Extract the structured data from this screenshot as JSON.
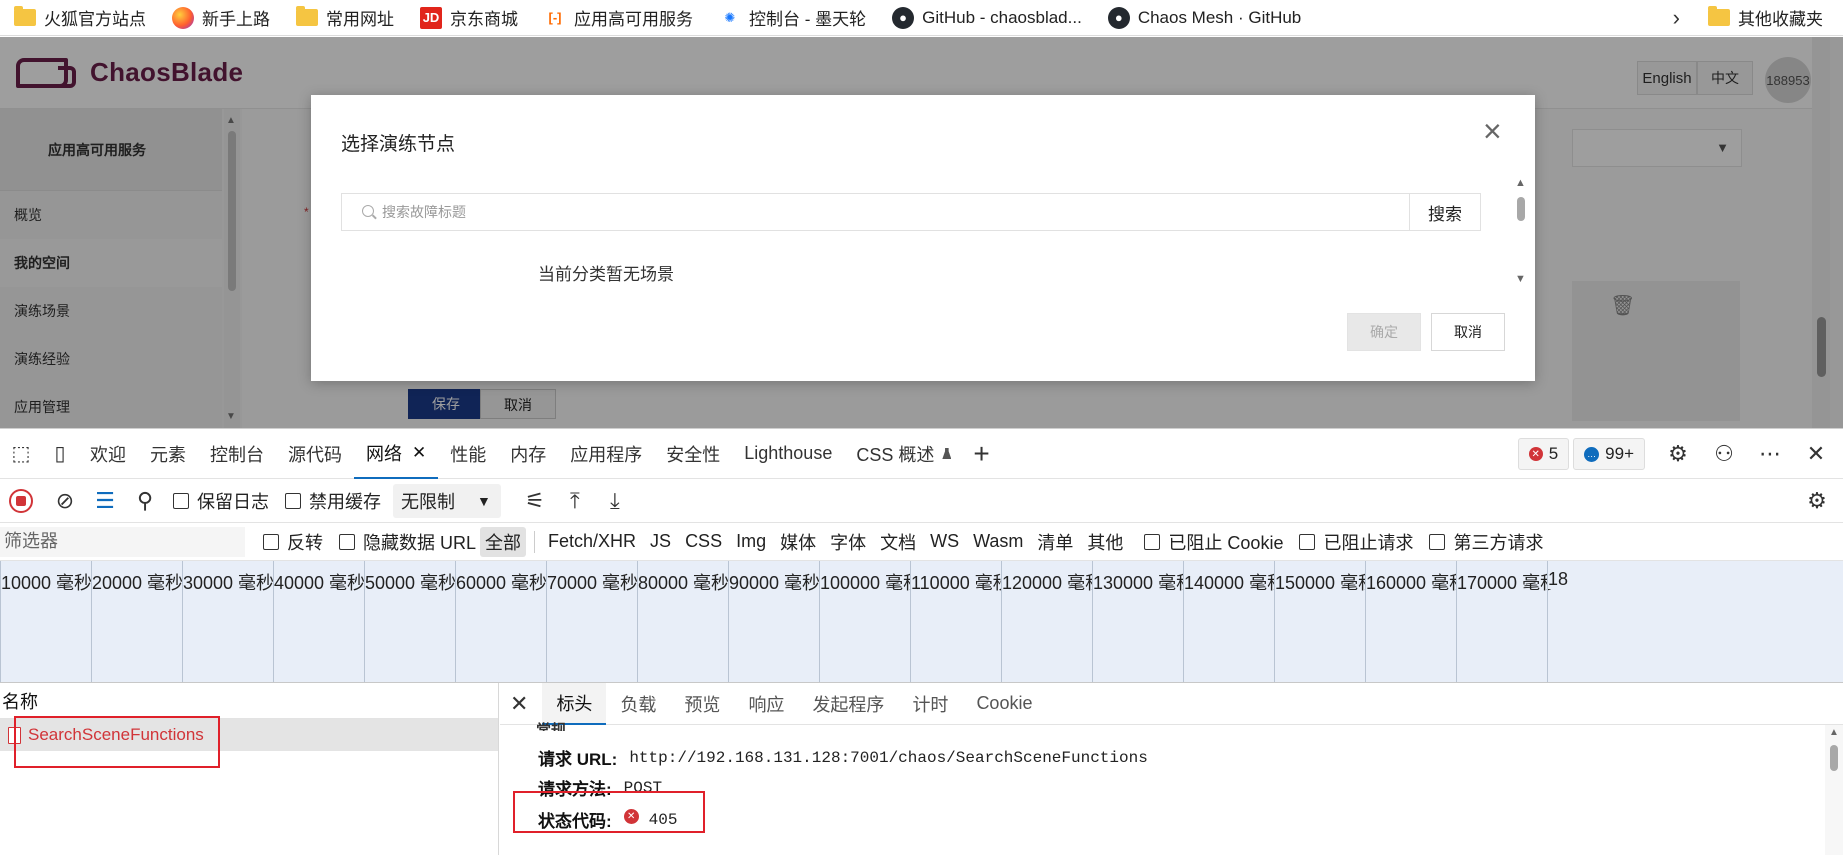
{
  "bookmarks": {
    "items": [
      {
        "label": "火狐官方站点",
        "icon": "folder-icon"
      },
      {
        "label": "新手上路",
        "icon": "firefox-icon"
      },
      {
        "label": "常用网址",
        "icon": "folder-icon"
      },
      {
        "label": "京东商城",
        "icon": "jd-icon",
        "icon_text": "JD"
      },
      {
        "label": "应用高可用服务",
        "icon": "aliyun-icon",
        "icon_text": "[-]"
      },
      {
        "label": "控制台 - 墨天轮",
        "icon": "modb-icon",
        "icon_text": "✺"
      },
      {
        "label": "GitHub - chaosblad...",
        "icon": "github-icon"
      },
      {
        "label": "Chaos Mesh · GitHub",
        "icon": "github-icon"
      }
    ],
    "more_icon": "chevron-right-icon",
    "other": {
      "label": "其他收藏夹",
      "icon": "folder-icon"
    }
  },
  "app": {
    "logo_text": "ChaosBlade",
    "lang_en": "English",
    "lang_zh": "中文",
    "avatar_text": "188953",
    "sidebar": {
      "title": "应用高可用服务",
      "items": [
        {
          "label": "概览",
          "active": false
        },
        {
          "label": "我的空间",
          "active": true
        },
        {
          "label": "演练场景",
          "active": false
        },
        {
          "label": "演练经验",
          "active": false
        },
        {
          "label": "应用管理",
          "active": false
        }
      ]
    },
    "required_mark": "*",
    "bg_save": "保存",
    "bg_cancel": "取消"
  },
  "modal": {
    "title": "选择演练节点",
    "search_placeholder": "搜索故障标题",
    "search_value": "",
    "search_button": "搜索",
    "empty_message": "当前分类暂无场景",
    "confirm": "确定",
    "cancel": "取消",
    "confirm_disabled": true
  },
  "devtools": {
    "tabs": [
      {
        "label": "欢迎",
        "active": false
      },
      {
        "label": "元素",
        "active": false
      },
      {
        "label": "控制台",
        "active": false
      },
      {
        "label": "源代码",
        "active": false
      },
      {
        "label": "网络",
        "active": true
      },
      {
        "label": "性能",
        "active": false
      },
      {
        "label": "内存",
        "active": false
      },
      {
        "label": "应用程序",
        "active": false
      },
      {
        "label": "安全性",
        "active": false
      },
      {
        "label": "Lighthouse",
        "active": false
      },
      {
        "label": "CSS 概述",
        "active": false
      }
    ],
    "error_count": "5",
    "message_count": "99+",
    "toolbar": {
      "preserve_log": "保留日志",
      "disable_cache": "禁用缓存",
      "throttle": "无限制"
    },
    "filter": {
      "placeholder": "筛选器",
      "invert": "反转",
      "hide_data_urls": "隐藏数据 URL",
      "types": [
        "全部",
        "Fetch/XHR",
        "JS",
        "CSS",
        "Img",
        "媒体",
        "字体",
        "文档",
        "WS",
        "Wasm",
        "清单",
        "其他"
      ],
      "active_type": "全部",
      "blocked_cookies": "已阻止 Cookie",
      "blocked_requests": "已阻止请求",
      "third_party": "第三方请求"
    },
    "timeline": {
      "unit": "毫秒",
      "ticks": [
        "10000",
        "20000",
        "30000",
        "40000",
        "50000",
        "60000",
        "70000",
        "80000",
        "90000",
        "100000",
        "110000",
        "120000",
        "130000",
        "140000",
        "150000",
        "160000",
        "170000",
        "18"
      ]
    },
    "requests": {
      "column_name": "名称",
      "rows": [
        {
          "name": "SearchSceneFunctions",
          "status": "error"
        }
      ]
    },
    "detail": {
      "tabs": [
        "标头",
        "负载",
        "预览",
        "响应",
        "发起程序",
        "计时",
        "Cookie"
      ],
      "active_tab": "标头",
      "section": "常规",
      "request_url_label": "请求 URL:",
      "request_url": "http://192.168.131.128:7001/chaos/SearchSceneFunctions",
      "method_label": "请求方法:",
      "method": "POST",
      "status_label": "状态代码:",
      "status": "405"
    }
  },
  "colors": {
    "brand": "#6b1f4b",
    "accent": "#0f6cbd",
    "error": "#d13438",
    "annotation": "#e0202a"
  }
}
